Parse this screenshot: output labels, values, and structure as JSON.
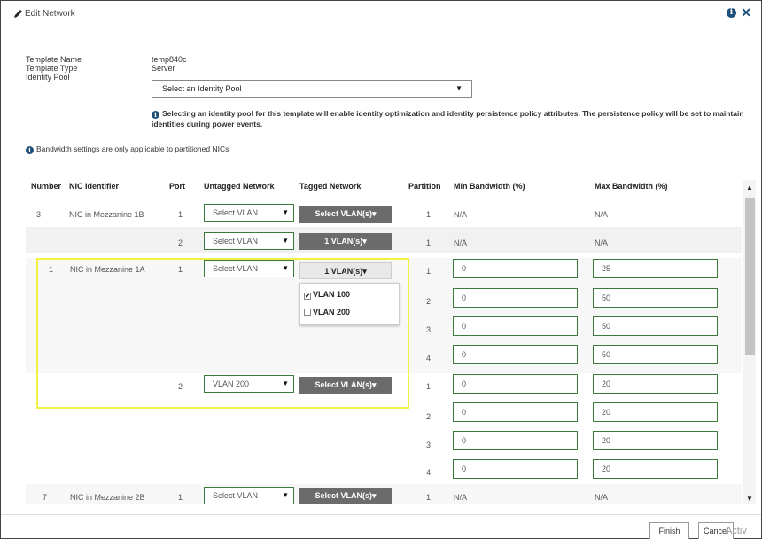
{
  "dialog": {
    "title": "Edit Network",
    "help_symbol": "i",
    "close_symbol": "✕"
  },
  "template": {
    "name_label": "Template Name",
    "type_label": "Template Type",
    "pool_label": "Identity Pool",
    "name_value": "temp840c",
    "type_value": "Server",
    "pool_selected": "Select an Identity Pool"
  },
  "notes": {
    "pool_note": "Selecting an identity pool for this template will enable identity optimization and identity persistence policy attributes. The persistence policy will be set to maintain identities during power events.",
    "bandwidth_note": "Bandwidth settings are only applicable to partitioned NICs"
  },
  "table": {
    "headers": {
      "number": "Number",
      "nic": "NIC Identifier",
      "port": "Port",
      "untagged": "Untagged Network",
      "tagged": "Tagged Network",
      "partition": "Partition",
      "min_bw": "Min Bandwidth (%)",
      "max_bw": "Max Bandwidth (%)"
    },
    "rows": [
      {
        "number": "3",
        "nic": "NIC in Mezzanine 1B",
        "port": "1",
        "untagged": "Select VLAN",
        "tagged": "Select VLAN(s)",
        "partition": "1",
        "min": "N/A",
        "max": "N/A"
      },
      {
        "number": "",
        "nic": "",
        "port": "2",
        "untagged": "Select VLAN",
        "tagged": "1 VLAN(s)",
        "partition": "1",
        "min": "N/A",
        "max": "N/A"
      },
      {
        "number": "1",
        "nic": "NIC in Mezzanine 1A",
        "port": "1",
        "untagged": "Select VLAN",
        "tagged": "1 VLAN(s)",
        "partition": "1",
        "min": "0",
        "max": "25"
      },
      {
        "number": "",
        "nic": "",
        "port": "",
        "untagged": "",
        "tagged": "",
        "partition": "2",
        "min": "0",
        "max": "50"
      },
      {
        "number": "",
        "nic": "",
        "port": "",
        "untagged": "",
        "tagged": "",
        "partition": "3",
        "min": "0",
        "max": "50"
      },
      {
        "number": "",
        "nic": "",
        "port": "",
        "untagged": "",
        "tagged": "",
        "partition": "4",
        "min": "0",
        "max": "50"
      },
      {
        "number": "",
        "nic": "",
        "port": "2",
        "untagged": "VLAN 200",
        "tagged": "Select VLAN(s)",
        "partition": "1",
        "min": "0",
        "max": "20"
      },
      {
        "number": "",
        "nic": "",
        "port": "",
        "untagged": "",
        "tagged": "",
        "partition": "2",
        "min": "0",
        "max": "20"
      },
      {
        "number": "",
        "nic": "",
        "port": "",
        "untagged": "",
        "tagged": "",
        "partition": "3",
        "min": "0",
        "max": "20"
      },
      {
        "number": "",
        "nic": "",
        "port": "",
        "untagged": "",
        "tagged": "",
        "partition": "4",
        "min": "0",
        "max": "20"
      },
      {
        "number": "7",
        "nic": "NIC in Mezzanine 2B",
        "port": "1",
        "untagged": "Select VLAN",
        "tagged": "Select VLAN(s)",
        "partition": "1",
        "min": "N/A",
        "max": "N/A"
      }
    ],
    "vlan_dropdown": [
      {
        "label": "VLAN 100",
        "checked": true
      },
      {
        "label": "VLAN 200",
        "checked": false
      }
    ]
  },
  "footer": {
    "finish_label": "Finish",
    "cancel_label": "Cancel",
    "watermark": "Activ"
  },
  "colors": {
    "accent": "#1e4f7a",
    "highlight": "#f1f043",
    "field_border": "#3b7a3b",
    "button_grey": "#6b6b6b"
  }
}
